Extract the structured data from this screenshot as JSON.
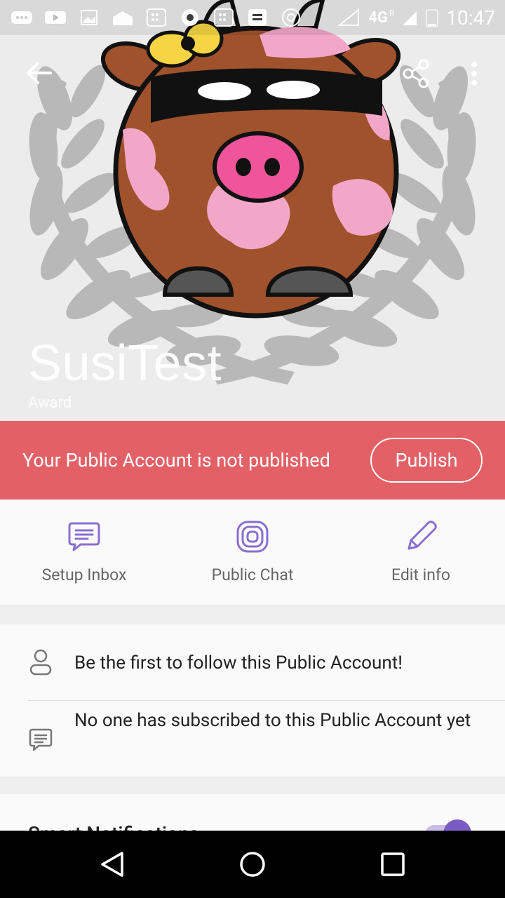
{
  "status_bar": {
    "network": "4G",
    "roaming": "R",
    "time": "10:47",
    "icons": [
      "chat-bubble-icon",
      "youtube-icon",
      "image-icon",
      "mail-open-icon",
      "app-grid-icon",
      "chrome-icon",
      "app-grid-icon",
      "app-grid-icon",
      "chrome-icon",
      "signal-icon",
      "battery-icon"
    ]
  },
  "app_bar": {
    "back_icon": "arrow-back-icon",
    "share_icon": "share-icon",
    "more_icon": "more-vert-icon"
  },
  "account": {
    "name": "SusiTest",
    "category": "Award"
  },
  "banner": {
    "message": "Your Public Account is not published",
    "button_label": "Publish",
    "color": "#e36166"
  },
  "actions": [
    {
      "label": "Setup Inbox",
      "icon": "chat-lines-icon"
    },
    {
      "label": "Public Chat",
      "icon": "public-chat-icon"
    },
    {
      "label": "Edit info",
      "icon": "pencil-icon"
    }
  ],
  "info": {
    "followers_text": "Be the first to follow this Public Account!",
    "subscribers_text": "No one has subscribed to this Public Account yet"
  },
  "smart_notifications": {
    "label": "Smart Notifications",
    "enabled": true
  },
  "colors": {
    "accent": "#7b5cc4",
    "icon_purple": "#8a6fd1"
  },
  "nav_bar": {
    "back": "nav-back-icon",
    "home": "nav-home-icon",
    "recents": "nav-recents-icon"
  }
}
